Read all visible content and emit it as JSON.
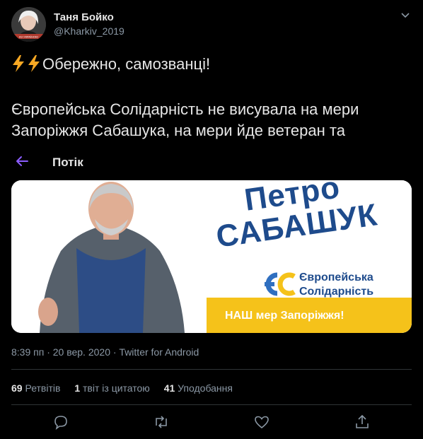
{
  "author": {
    "display_name": "Таня Бойко",
    "handle": "@Kharkiv_2019",
    "avatar_caption": "АЗ УКРАЇНОЮ"
  },
  "tweet": {
    "line1": "Обережно, самозванці!",
    "body": "Європейська Солідарність не висувала на мери Запоріжжя Сабашука, на мери йде ветеран та"
  },
  "overlay": {
    "title": "Потік"
  },
  "media": {
    "first_name": "Петро",
    "last_name": "САБАШУК",
    "party_line1": "Європейська",
    "party_line2": "Солідарність",
    "slogan": "НАШ мер Запоріжжя!"
  },
  "meta": {
    "timestamp": "8:39 пп · 20 вер. 2020 · Twitter for Android"
  },
  "stats": {
    "retweets_count": "69",
    "retweets_label": "Ретвітів",
    "quotes_count": "1",
    "quotes_label": "твіт із цитатою",
    "likes_count": "41",
    "likes_label": "Уподобання"
  },
  "icons": {
    "reply": "reply-icon",
    "retweet": "retweet-icon",
    "like": "heart-icon",
    "share": "share-icon",
    "back": "back-arrow-icon",
    "caret": "chevron-down-icon",
    "bolt": "lightning-icon"
  },
  "colors": {
    "accent": "#8c5dff",
    "brand_blue": "#1e4b8c",
    "slogan_yellow": "#f5c21a",
    "muted": "#8b98a5"
  }
}
